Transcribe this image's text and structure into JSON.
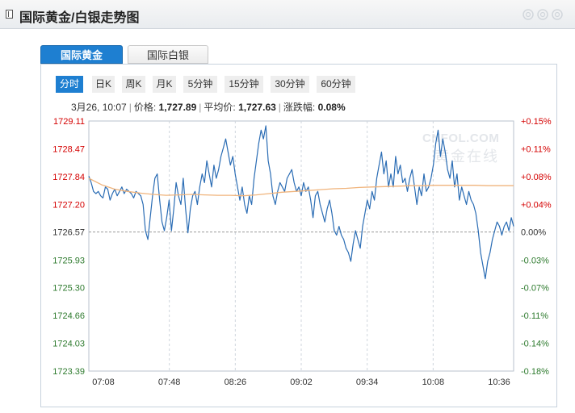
{
  "header": {
    "title": "国际黄金/白银走势图"
  },
  "tabs": [
    {
      "label": "国际黄金",
      "active": true
    },
    {
      "label": "国际白银",
      "active": false
    }
  ],
  "periods": [
    {
      "label": "分时",
      "active": true
    },
    {
      "label": "日K",
      "active": false
    },
    {
      "label": "周K",
      "active": false
    },
    {
      "label": "月K",
      "active": false
    },
    {
      "label": "5分钟",
      "active": false
    },
    {
      "label": "15分钟",
      "active": false
    },
    {
      "label": "30分钟",
      "active": false
    },
    {
      "label": "60分钟",
      "active": false
    }
  ],
  "info": {
    "datetime": "3月26, 10:07",
    "price_label": "价格:",
    "price_value": "1,727.89",
    "avg_label": "平均价:",
    "avg_value": "1,727.63",
    "change_label": "涨跌幅:",
    "change_value": "0.08%"
  },
  "watermark": {
    "brand": "CNFOL.COM",
    "cn": "黄金在线"
  },
  "colors": {
    "accent": "#1e7fd1",
    "price_line": "#2a6cb4",
    "avg_line": "#f0b47c",
    "up": "#d40000",
    "down": "#2d7a2d"
  },
  "chart_data": {
    "type": "line",
    "x_ticks": [
      "07:08",
      "07:48",
      "08:26",
      "09:02",
      "09:34",
      "10:08",
      "10:36"
    ],
    "y_ticks_left": [
      "1729.11",
      "1728.47",
      "1727.84",
      "1727.20",
      "1726.57",
      "1725.93",
      "1725.30",
      "1724.66",
      "1724.03",
      "1723.39"
    ],
    "y_ticks_right": [
      "+0.15%",
      "+0.11%",
      "+0.08%",
      "+0.04%",
      "0.00%",
      "-0.03%",
      "-0.07%",
      "-0.11%",
      "-0.14%",
      "-0.18%"
    ],
    "ylim": [
      1723.39,
      1729.11
    ],
    "baseline": 1726.57,
    "series": [
      {
        "values": [
          1727.85,
          1727.7,
          1727.5,
          1727.45,
          1727.5,
          1727.4,
          1727.35,
          1727.6,
          1727.55,
          1727.3,
          1727.45,
          1727.55,
          1727.4,
          1727.5,
          1727.6,
          1727.45,
          1727.55,
          1727.5,
          1727.45,
          1727.35,
          1727.5,
          1727.45,
          1727.4,
          1727.2,
          1726.6,
          1726.4,
          1726.9,
          1727.4,
          1727.8,
          1727.9,
          1727.3,
          1726.8,
          1726.6,
          1726.9,
          1727.3,
          1726.6,
          1727.1,
          1727.7,
          1727.4,
          1727.2,
          1727.8,
          1727.1,
          1726.55,
          1727.1,
          1727.4,
          1727.5,
          1727.2,
          1727.6,
          1727.9,
          1727.7,
          1728.2,
          1727.9,
          1727.6,
          1728.1,
          1727.8,
          1728.0,
          1728.3,
          1728.5,
          1728.7,
          1728.4,
          1728.1,
          1728.3,
          1727.9,
          1727.6,
          1727.3,
          1727.6,
          1727.2,
          1727.0,
          1727.4,
          1727.2,
          1727.8,
          1728.2,
          1728.6,
          1728.9,
          1728.7,
          1729.0,
          1728.2,
          1727.9,
          1727.4,
          1727.2,
          1727.5,
          1727.7,
          1727.6,
          1727.5,
          1727.8,
          1727.9,
          1728.0,
          1727.7,
          1727.5,
          1727.6,
          1727.4,
          1727.7,
          1727.5,
          1727.6,
          1727.3,
          1726.9,
          1727.4,
          1727.5,
          1727.2,
          1727.0,
          1726.8,
          1727.1,
          1727.3,
          1727.0,
          1726.6,
          1726.5,
          1726.7,
          1726.5,
          1726.4,
          1726.2,
          1726.1,
          1725.9,
          1726.3,
          1726.6,
          1726.4,
          1726.2,
          1726.7,
          1727.0,
          1727.3,
          1727.1,
          1727.5,
          1727.3,
          1727.8,
          1728.1,
          1728.4,
          1727.9,
          1728.2,
          1727.6,
          1727.9,
          1727.6,
          1728.3,
          1727.9,
          1728.1,
          1727.7,
          1727.8,
          1727.5,
          1727.8,
          1728.0,
          1727.6,
          1727.2,
          1727.6,
          1727.4,
          1727.9,
          1727.5,
          1727.6,
          1727.8,
          1728.1,
          1728.6,
          1728.9,
          1728.3,
          1728.7,
          1728.4,
          1728.0,
          1727.8,
          1728.2,
          1727.6,
          1727.9,
          1727.3,
          1727.6,
          1727.4,
          1727.2,
          1727.5,
          1727.3,
          1727.2,
          1727.0,
          1726.6,
          1726.1,
          1725.8,
          1725.5,
          1725.9,
          1726.1,
          1726.4,
          1726.6,
          1726.8,
          1726.7,
          1726.5,
          1726.7,
          1726.8,
          1726.6,
          1726.9,
          1726.7
        ],
        "color": "#2a6cb4"
      },
      {
        "values": [
          1727.8,
          1727.65,
          1727.55,
          1727.5,
          1727.46,
          1727.43,
          1727.41,
          1727.42,
          1727.43,
          1727.42,
          1727.41,
          1727.41,
          1727.4,
          1727.42,
          1727.45,
          1727.48,
          1727.5,
          1727.52,
          1727.54,
          1727.56,
          1727.57,
          1727.59,
          1727.6,
          1727.61,
          1727.62,
          1727.63,
          1727.63,
          1727.64,
          1727.64,
          1727.64,
          1727.64,
          1727.63,
          1727.63,
          1727.63
        ],
        "color": "#f0b47c"
      }
    ]
  }
}
